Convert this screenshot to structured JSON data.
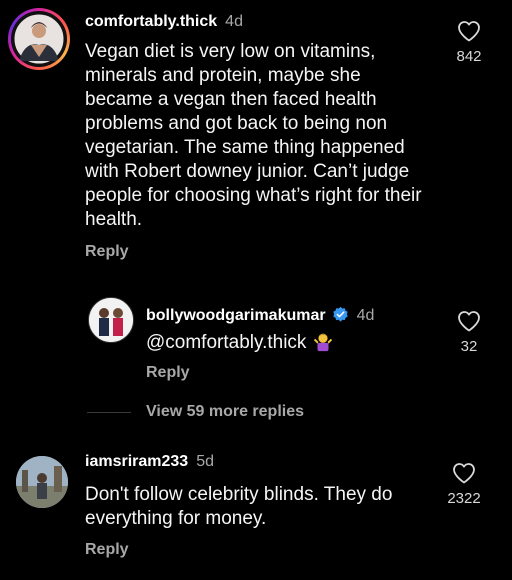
{
  "comments": [
    {
      "username": "comfortably.thick",
      "time": "4d",
      "text": "Vegan diet is very low on vitamins, minerals and protein, maybe she became a vegan then faced health problems and got back to being non vegetarian. The same thing happened with Robert downey junior. Can’t judge people for choosing what’s right for their health.",
      "reply_label": "Reply",
      "like_count": "842"
    },
    {
      "username": "bollywoodgarimakumar",
      "verified": true,
      "time": "4d",
      "text": "@comfortably.thick",
      "emoji": "person-shrugging-emoji",
      "reply_label": "Reply",
      "like_count": "32"
    },
    {
      "username": "iamsriram233",
      "time": "5d",
      "text": "Don't follow celebrity blinds. They do everything for money.",
      "reply_label": "Reply",
      "like_count": "2322"
    }
  ],
  "view_more_replies": "View 59 more replies",
  "icons": {
    "like": "heart-outline-icon",
    "verified": "verified-badge-icon"
  },
  "colors": {
    "background": "#000000",
    "text": "#f5f5f5",
    "muted": "#a8a8a8",
    "verified": "#3897f0",
    "story_ring_start": "#d6249f",
    "story_ring_end": "#fdb44b"
  }
}
